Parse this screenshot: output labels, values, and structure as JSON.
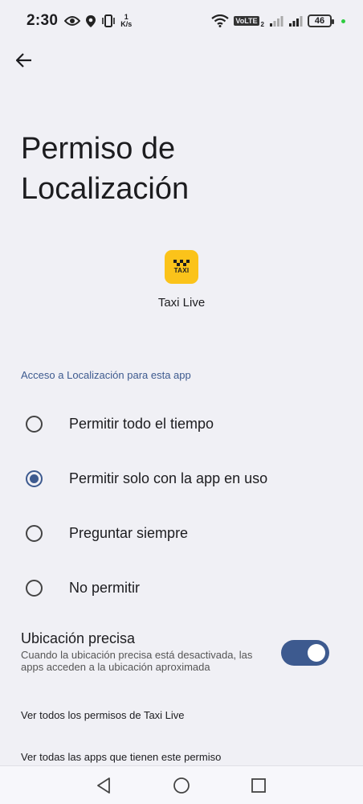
{
  "status_bar": {
    "time": "2:30",
    "net_speed_value": "1",
    "net_speed_unit": "K/s",
    "volte": "VoLTE",
    "volte_sub": "2",
    "battery": "46"
  },
  "page": {
    "title_line1": "Permiso de",
    "title_line2": "Localización",
    "app_icon_text": "TAXI",
    "app_name": "Taxi Live",
    "section_header": "Acceso a Localización para esta app"
  },
  "options": [
    {
      "label": "Permitir todo el tiempo",
      "selected": false
    },
    {
      "label": "Permitir solo con la app en uso",
      "selected": true
    },
    {
      "label": "Preguntar siempre",
      "selected": false
    },
    {
      "label": "No permitir",
      "selected": false
    }
  ],
  "precise": {
    "title": "Ubicación precisa",
    "description": "Cuando la ubicación precisa está desactivada, las apps acceden a la ubicación aproximada",
    "enabled": true
  },
  "links": {
    "all_permissions": "Ver todos los permisos de Taxi Live",
    "all_apps": "Ver todas las apps que tienen este permiso"
  },
  "colors": {
    "accent": "#3d5a8f",
    "background": "#f0f0f5",
    "app_icon_bg": "#fbc31a"
  },
  "icons": {
    "back": "arrow-left-icon",
    "nav_back": "triangle-back-icon",
    "nav_home": "circle-home-icon",
    "nav_recents": "square-recents-icon"
  }
}
